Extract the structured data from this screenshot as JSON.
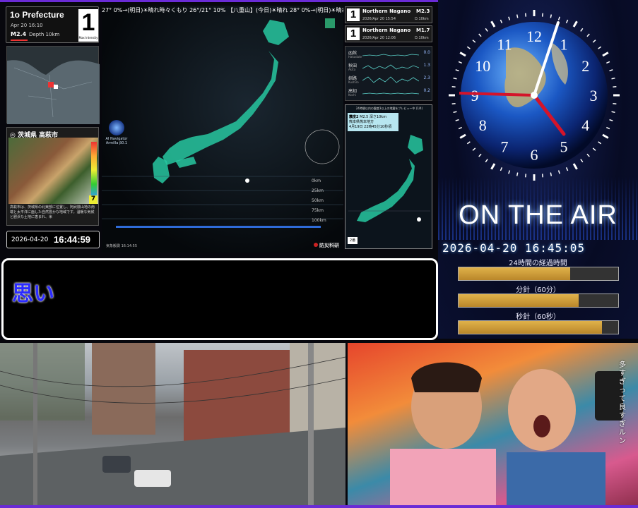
{
  "left": {
    "prefecture_count": "1o Prefecture",
    "date": "Apr 20 16:10",
    "magnitude": "M2.4",
    "depth": "Depth 10km",
    "max_intensity": "1",
    "max_intensity_label": "Max Intensity",
    "photo_location": "茨城県 高萩市",
    "photo_badge": "7",
    "photo_description": "高萩市は、茨城県の北東部に位置し、阿武隈山地の南端と太平洋に面した自然豊かな地域です。温暖な気候と肥沃な土地に恵まれ、米",
    "clock_date": "2026-04-20",
    "clock_time": "16:44:59"
  },
  "map": {
    "ticker": "27° 0%→(明日)☀晴れ時々くもり 26°/21° 10% 【八重山】(今日)☀晴れ 28° 0%→(明日)☀晴れ時々くも",
    "ai_navigator": "AI Navigator Armilla β0.1",
    "scale": [
      "0km",
      "25km",
      "50km",
      "75km",
      "100km"
    ],
    "timestamp": "気象観測 16:14:55",
    "provider": "防災科研"
  },
  "quakes": [
    {
      "intensity": "1",
      "region": "Northern Nagano Prefecture",
      "magnitude": "M2.3",
      "datetime": "2026/Apr 20 15:54",
      "depth": "D.10km"
    },
    {
      "intensity": "1",
      "region": "Northern Nagano Prefecture",
      "magnitude": "M1.7",
      "datetime": "2026/Apr 20 12:06",
      "depth": "D.10km"
    }
  ],
  "waves": [
    {
      "name": "函館",
      "sub": "Hakodate",
      "value": "0.0"
    },
    {
      "name": "秋田",
      "sub": "Akita",
      "value": "1.3"
    },
    {
      "name": "釧路",
      "sub": "Kushiro",
      "value": "2.3"
    },
    {
      "name": "高知",
      "sub": "Kochi",
      "value": "0.2"
    }
  ],
  "preview": {
    "header": "24時間以内の震度3以上の地震をプレビュー中 (1/4)",
    "title": "震度2",
    "magnitude": "M2.5 深さ10km",
    "region": "熊本県熊本地方",
    "time": "4月19日 22時45分10秒頃",
    "badge": "2番"
  },
  "clock": {
    "numbers": [
      "12",
      "1",
      "2",
      "3",
      "4",
      "5",
      "6",
      "7",
      "8",
      "9",
      "10",
      "11"
    ],
    "on_air": "ON THE AIR",
    "datetime": "2026-04-20 16:45:05",
    "progress": [
      {
        "label": "24時間の経過時間",
        "value": 0.7
      },
      {
        "label": "分針（60分）",
        "value": 0.75
      },
      {
        "label": "秒針（60秒）",
        "value": 0.9
      }
    ],
    "accent": "#e0b24a"
  },
  "subtitle": {
    "text": "思い"
  },
  "tv": {
    "caption": "多すぎって良すぎルン"
  },
  "colors": {
    "frame": "#6a2bd6",
    "map_land": "#27c7a0",
    "subtitle_text": "#2b2bff"
  }
}
